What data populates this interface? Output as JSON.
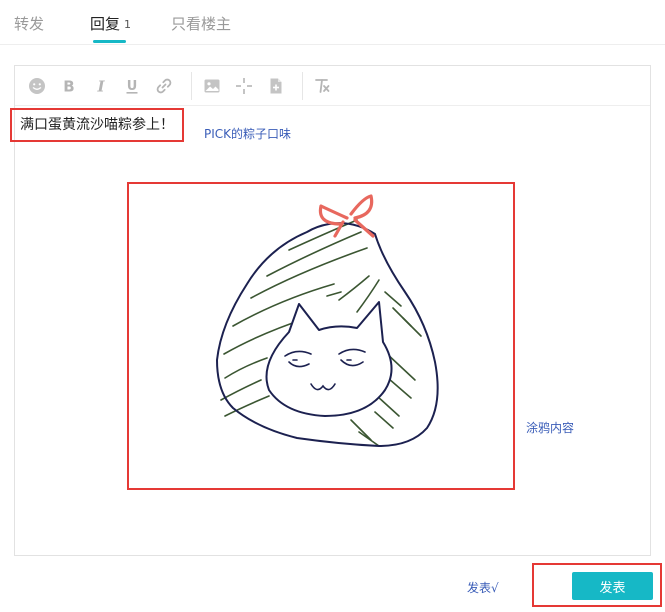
{
  "tabs": [
    {
      "label": "转发",
      "count": ""
    },
    {
      "label": "回复",
      "count": "1"
    },
    {
      "label": "只看楼主",
      "count": ""
    }
  ],
  "toolbar": {
    "icons": [
      "emoji-icon",
      "bold-icon",
      "italic-icon",
      "underline-icon",
      "link-icon",
      "image-icon",
      "doodle-icon",
      "file-icon",
      "clear-format-icon"
    ],
    "bold_glyph": "B",
    "italic_glyph": "I",
    "underline_glyph": "U"
  },
  "editor": {
    "content_text": "满口蛋黄流沙喵粽参上！"
  },
  "annotations": {
    "pick": "PICK的粽子口味",
    "doodle": "涂鸦内容",
    "publish": "发表√"
  },
  "actions": {
    "publish_label": "发表"
  },
  "colors": {
    "accent": "#16b8c6",
    "highlight_box": "#e53935",
    "annotation_text": "#3a5db8",
    "ribbon": "#e8685e",
    "outline": "#1c2150",
    "stripe": "#3b5632"
  }
}
